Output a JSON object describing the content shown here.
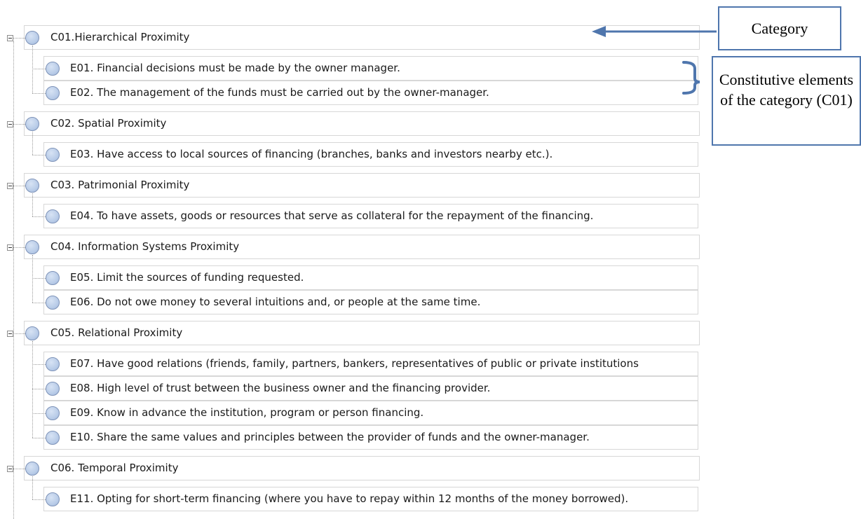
{
  "tree": [
    {
      "label": "C01.Hierarchical Proximity",
      "children": [
        "E01. Financial decisions must be made by the owner manager.",
        "E02. The management of the funds must be carried out by the owner-manager."
      ]
    },
    {
      "label": "C02. Spatial Proximity",
      "children": [
        "E03. Have access to local sources of financing (branches, banks and investors nearby etc.)."
      ]
    },
    {
      "label": "C03. Patrimonial Proximity",
      "children": [
        "E04. To have assets, goods or resources that serve as collateral for the repayment of the financing."
      ]
    },
    {
      "label": "C04. Information Systems Proximity",
      "children": [
        "E05. Limit the sources of funding requested.",
        "E06. Do not owe money to several intuitions and, or people at the same time."
      ]
    },
    {
      "label": "C05. Relational Proximity",
      "children": [
        "E07. Have good relations (friends, family, partners, bankers, representatives of public or private institutions",
        "E08. High level of trust between the business owner and the financing provider.",
        "E09. Know in advance the institution, program or person financing.",
        "E10. Share the same values and principles between the provider of funds and the owner-manager."
      ]
    },
    {
      "label": "C06. Temporal Proximity",
      "children": [
        "E11. Opting for short-term financing (where you have to repay within 12 months of the money borrowed)."
      ]
    }
  ],
  "annotations": {
    "category": "Category",
    "elements": "Constitutive elements of the category (C01)"
  },
  "colors": {
    "annotation_border": "#4f76ad",
    "row_border": "#d7d7d7"
  }
}
